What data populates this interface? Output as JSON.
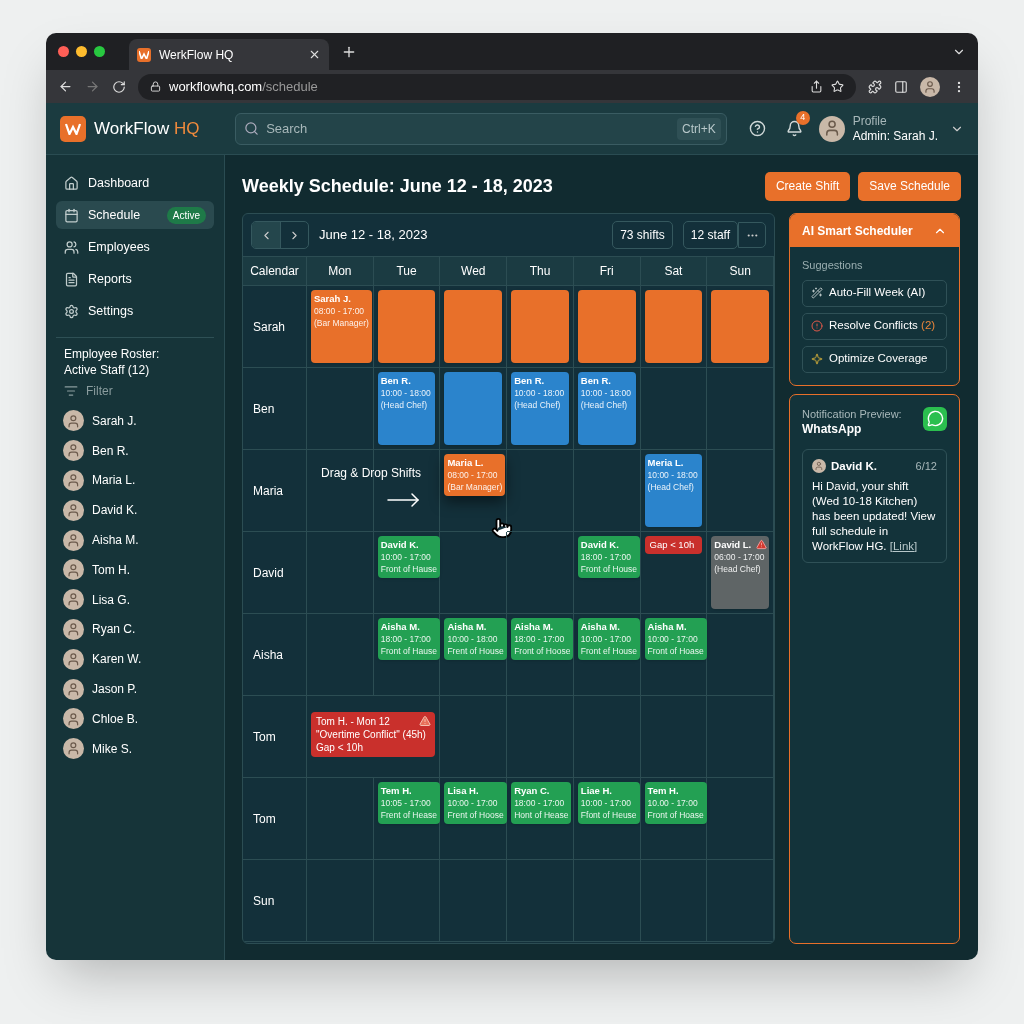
{
  "browser": {
    "tab_title": "WerkFlow HQ",
    "url_host": "workflowhq.com",
    "url_path": "/schedule"
  },
  "header": {
    "logo_text": "WorkFlow",
    "logo_accent": "HQ",
    "search_placeholder": "Search",
    "shortcut": "Ctrl+K",
    "notification_count": "4",
    "profile_label": "Profile",
    "profile_name": "Admin: Sarah J."
  },
  "sidebar": {
    "items": [
      {
        "label": "Dashboard",
        "selected": false
      },
      {
        "label": "Schedule",
        "selected": true,
        "badge": "Active"
      },
      {
        "label": "Employees",
        "selected": false
      },
      {
        "label": "Reports",
        "selected": false
      },
      {
        "label": "Settings",
        "selected": false
      }
    ],
    "roster_title": "Employee Roster: Active Staff (12)",
    "filter_placeholder": "Filter",
    "staff": [
      "Sarah J.",
      "Ben R.",
      "Maria L.",
      "David K.",
      "Aisha M.",
      "Tom H.",
      "Lisa G.",
      "Ryan C.",
      "Karen W.",
      "Jason P.",
      "Chloe B.",
      "Mike S."
    ]
  },
  "page": {
    "title": "Weekly Schedule: June 12 - 18, 2023",
    "buttons": [
      "Create Shift",
      "Save Schedule"
    ]
  },
  "calendar": {
    "range": "June 12 - 18, 2023",
    "counts": [
      "73 shifts",
      "12 staff"
    ],
    "corner": "Calendar",
    "columns": [
      "Mon",
      "Tue",
      "Wed",
      "Thu",
      "Fri",
      "Sat",
      "Sun"
    ],
    "rows": [
      {
        "label": "Sarah",
        "cells": [
          {
            "kind": "shift",
            "color": "#e8702a",
            "tall": true,
            "lines": [
              "Sarah J.",
              "08:00 - 17:00",
              "(Bar Manager)"
            ]
          },
          {
            "kind": "shift",
            "color": "#e8702a",
            "tall": true
          },
          {
            "kind": "shift",
            "color": "#e8702a",
            "tall": true
          },
          {
            "kind": "shift",
            "color": "#e8702a",
            "tall": true
          },
          {
            "kind": "shift",
            "color": "#e8702a",
            "tall": true
          },
          {
            "kind": "shift",
            "color": "#e8702a",
            "tall": true
          },
          {
            "kind": "shift",
            "color": "#e8702a",
            "tall": true
          }
        ]
      },
      {
        "label": "Ben",
        "cells": [
          {
            "kind": "empty"
          },
          {
            "kind": "shift",
            "color": "#2b84cc",
            "tall": true,
            "lines": [
              "Ben R.",
              "10:00 - 18:00",
              "(Head Chef)"
            ]
          },
          {
            "kind": "shift",
            "color": "#2b84cc",
            "tall": true
          },
          {
            "kind": "shift",
            "color": "#2b84cc",
            "tall": true,
            "lines": [
              "Ben R.",
              "10:00 - 18:00",
              "(Head Chef)"
            ]
          },
          {
            "kind": "shift",
            "color": "#2b84cc",
            "tall": true,
            "lines": [
              "Ben R.",
              "10:00 - 18:00",
              "(Head Chef)"
            ]
          },
          {
            "kind": "empty"
          },
          {
            "kind": "empty"
          }
        ]
      },
      {
        "label": "Maria",
        "annotation": "Drag & Drop Shifts",
        "cells": [
          {
            "kind": "empty"
          },
          {
            "kind": "empty"
          },
          {
            "kind": "shift",
            "color": "#e8702a",
            "tall": false,
            "dragging": true,
            "lines": [
              "Maria L.",
              "08:00 - 17:00",
              "(Bar Manager)"
            ]
          },
          {
            "kind": "empty"
          },
          {
            "kind": "empty"
          },
          {
            "kind": "shift",
            "color": "#2b84cc",
            "tall": true,
            "lines": [
              "Meria L.",
              "10:00 - 18:00",
              "(Head Chef)"
            ]
          },
          {
            "kind": "empty"
          }
        ]
      },
      {
        "label": "David",
        "cells": [
          {
            "kind": "empty"
          },
          {
            "kind": "shift",
            "color": "#23a053",
            "tall": false,
            "lines": [
              "David K.",
              "10:00 - 17:00",
              "Front of Hause"
            ]
          },
          {
            "kind": "empty"
          },
          {
            "kind": "empty"
          },
          {
            "kind": "shift",
            "color": "#23a053",
            "tall": false,
            "lines": [
              "David K.",
              "18:00 - 17:00",
              "Front of House"
            ]
          },
          {
            "kind": "gap",
            "text": "Gap < 10h"
          },
          {
            "kind": "shift",
            "color": "#5f6566",
            "tall": true,
            "warning": true,
            "lines": [
              "David L.",
              "06:00 - 17:00",
              "(Head Chef)"
            ]
          }
        ]
      },
      {
        "label": "Aisha",
        "cells": [
          {
            "kind": "empty"
          },
          {
            "kind": "shift",
            "color": "#23a053",
            "tall": false,
            "lines": [
              "Aisha M.",
              "18:00 - 17:00",
              "Front of Hause"
            ]
          },
          {
            "kind": "shift",
            "color": "#23a053",
            "tall": false,
            "lines": [
              "Aisha M.",
              "10:00 - 18:00",
              "Frent of House"
            ]
          },
          {
            "kind": "shift",
            "color": "#23a053",
            "tall": false,
            "lines": [
              "Aisha M.",
              "18:00 - 17:00",
              "Front of Hoose"
            ]
          },
          {
            "kind": "shift",
            "color": "#23a053",
            "tall": false,
            "lines": [
              "Aisha M.",
              "10:00 - 17:00",
              "Front ef House"
            ]
          },
          {
            "kind": "shift",
            "color": "#23a053",
            "tall": false,
            "lines": [
              "Aisha M.",
              "10:00 - 17:00",
              "Front of Hoase"
            ]
          },
          {
            "kind": "empty"
          }
        ]
      },
      {
        "label": "Tom",
        "cells": [
          {
            "kind": "conflict",
            "wide": true,
            "warning": true,
            "lines": [
              "Tom H. - Mon 12",
              "\"Overtime Conflict\" (45h)",
              "Gap < 10h"
            ]
          },
          {
            "kind": "empty"
          },
          {
            "kind": "empty"
          },
          {
            "kind": "empty"
          },
          {
            "kind": "empty"
          },
          {
            "kind": "empty"
          }
        ]
      },
      {
        "label": "Tom",
        "cells": [
          {
            "kind": "empty"
          },
          {
            "kind": "shift",
            "color": "#23a053",
            "tall": false,
            "lines": [
              "Tem H.",
              "10:05 - 17:00",
              "Frent of Hease"
            ]
          },
          {
            "kind": "shift",
            "color": "#23a053",
            "tall": false,
            "lines": [
              "Lisa H.",
              "10:00 - 17:00",
              "Frent of Hoose"
            ]
          },
          {
            "kind": "shift",
            "color": "#23a053",
            "tall": false,
            "lines": [
              "Ryan C.",
              "18:00 - 17:00",
              "Hont of Hease"
            ]
          },
          {
            "kind": "shift",
            "color": "#23a053",
            "tall": false,
            "lines": [
              "Liae H.",
              "10:00 - 17:00",
              "Ffont of Heuse"
            ]
          },
          {
            "kind": "shift",
            "color": "#23a053",
            "tall": false,
            "lines": [
              "Tem H.",
              "10.00 - 17:00",
              "Front of Hoase"
            ]
          },
          {
            "kind": "empty"
          }
        ]
      },
      {
        "label": "Sun",
        "cells": [
          {
            "kind": "empty"
          },
          {
            "kind": "empty"
          },
          {
            "kind": "empty"
          },
          {
            "kind": "empty"
          },
          {
            "kind": "empty"
          },
          {
            "kind": "empty"
          },
          {
            "kind": "empty"
          }
        ]
      }
    ]
  },
  "ai_panel": {
    "title": "AI Smart Scheduler",
    "expanded": true,
    "section": "Suggestions",
    "actions": [
      {
        "kind": "autofill",
        "label": "Auto-Fill Week (AI)"
      },
      {
        "kind": "conflicts",
        "label": "Resolve Conflicts",
        "count": "(2)"
      },
      {
        "kind": "coverage",
        "label": "Optimize Coverage"
      }
    ]
  },
  "notification": {
    "label": "Notification Preview:",
    "app": "WhatsApp",
    "sender": "David K.",
    "date": "6/12",
    "message": "Hi David, your shift (Wed 10-18 Kitchen) has been updated! View full schedule in WorkFlow HG.",
    "link": "[Link]"
  }
}
